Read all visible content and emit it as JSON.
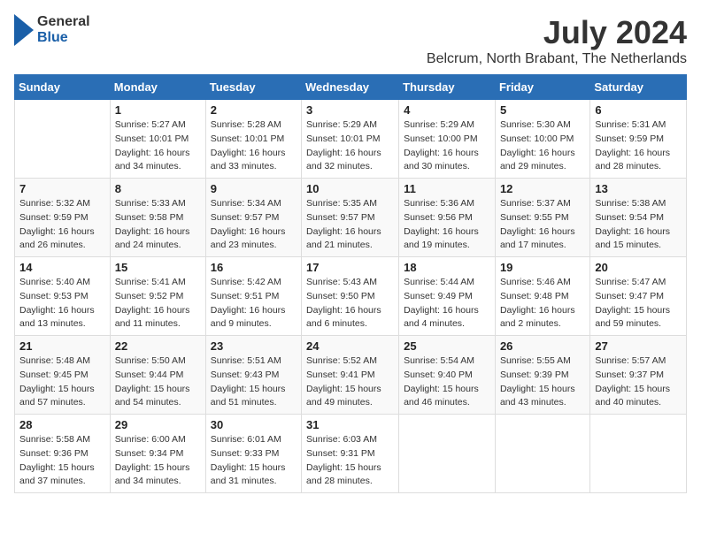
{
  "header": {
    "logo_general": "General",
    "logo_blue": "Blue",
    "month": "July 2024",
    "location": "Belcrum, North Brabant, The Netherlands"
  },
  "weekdays": [
    "Sunday",
    "Monday",
    "Tuesday",
    "Wednesday",
    "Thursday",
    "Friday",
    "Saturday"
  ],
  "weeks": [
    [
      {
        "day": "",
        "info": ""
      },
      {
        "day": "1",
        "info": "Sunrise: 5:27 AM\nSunset: 10:01 PM\nDaylight: 16 hours\nand 34 minutes."
      },
      {
        "day": "2",
        "info": "Sunrise: 5:28 AM\nSunset: 10:01 PM\nDaylight: 16 hours\nand 33 minutes."
      },
      {
        "day": "3",
        "info": "Sunrise: 5:29 AM\nSunset: 10:01 PM\nDaylight: 16 hours\nand 32 minutes."
      },
      {
        "day": "4",
        "info": "Sunrise: 5:29 AM\nSunset: 10:00 PM\nDaylight: 16 hours\nand 30 minutes."
      },
      {
        "day": "5",
        "info": "Sunrise: 5:30 AM\nSunset: 10:00 PM\nDaylight: 16 hours\nand 29 minutes."
      },
      {
        "day": "6",
        "info": "Sunrise: 5:31 AM\nSunset: 9:59 PM\nDaylight: 16 hours\nand 28 minutes."
      }
    ],
    [
      {
        "day": "7",
        "info": "Sunrise: 5:32 AM\nSunset: 9:59 PM\nDaylight: 16 hours\nand 26 minutes."
      },
      {
        "day": "8",
        "info": "Sunrise: 5:33 AM\nSunset: 9:58 PM\nDaylight: 16 hours\nand 24 minutes."
      },
      {
        "day": "9",
        "info": "Sunrise: 5:34 AM\nSunset: 9:57 PM\nDaylight: 16 hours\nand 23 minutes."
      },
      {
        "day": "10",
        "info": "Sunrise: 5:35 AM\nSunset: 9:57 PM\nDaylight: 16 hours\nand 21 minutes."
      },
      {
        "day": "11",
        "info": "Sunrise: 5:36 AM\nSunset: 9:56 PM\nDaylight: 16 hours\nand 19 minutes."
      },
      {
        "day": "12",
        "info": "Sunrise: 5:37 AM\nSunset: 9:55 PM\nDaylight: 16 hours\nand 17 minutes."
      },
      {
        "day": "13",
        "info": "Sunrise: 5:38 AM\nSunset: 9:54 PM\nDaylight: 16 hours\nand 15 minutes."
      }
    ],
    [
      {
        "day": "14",
        "info": "Sunrise: 5:40 AM\nSunset: 9:53 PM\nDaylight: 16 hours\nand 13 minutes."
      },
      {
        "day": "15",
        "info": "Sunrise: 5:41 AM\nSunset: 9:52 PM\nDaylight: 16 hours\nand 11 minutes."
      },
      {
        "day": "16",
        "info": "Sunrise: 5:42 AM\nSunset: 9:51 PM\nDaylight: 16 hours\nand 9 minutes."
      },
      {
        "day": "17",
        "info": "Sunrise: 5:43 AM\nSunset: 9:50 PM\nDaylight: 16 hours\nand 6 minutes."
      },
      {
        "day": "18",
        "info": "Sunrise: 5:44 AM\nSunset: 9:49 PM\nDaylight: 16 hours\nand 4 minutes."
      },
      {
        "day": "19",
        "info": "Sunrise: 5:46 AM\nSunset: 9:48 PM\nDaylight: 16 hours\nand 2 minutes."
      },
      {
        "day": "20",
        "info": "Sunrise: 5:47 AM\nSunset: 9:47 PM\nDaylight: 15 hours\nand 59 minutes."
      }
    ],
    [
      {
        "day": "21",
        "info": "Sunrise: 5:48 AM\nSunset: 9:45 PM\nDaylight: 15 hours\nand 57 minutes."
      },
      {
        "day": "22",
        "info": "Sunrise: 5:50 AM\nSunset: 9:44 PM\nDaylight: 15 hours\nand 54 minutes."
      },
      {
        "day": "23",
        "info": "Sunrise: 5:51 AM\nSunset: 9:43 PM\nDaylight: 15 hours\nand 51 minutes."
      },
      {
        "day": "24",
        "info": "Sunrise: 5:52 AM\nSunset: 9:41 PM\nDaylight: 15 hours\nand 49 minutes."
      },
      {
        "day": "25",
        "info": "Sunrise: 5:54 AM\nSunset: 9:40 PM\nDaylight: 15 hours\nand 46 minutes."
      },
      {
        "day": "26",
        "info": "Sunrise: 5:55 AM\nSunset: 9:39 PM\nDaylight: 15 hours\nand 43 minutes."
      },
      {
        "day": "27",
        "info": "Sunrise: 5:57 AM\nSunset: 9:37 PM\nDaylight: 15 hours\nand 40 minutes."
      }
    ],
    [
      {
        "day": "28",
        "info": "Sunrise: 5:58 AM\nSunset: 9:36 PM\nDaylight: 15 hours\nand 37 minutes."
      },
      {
        "day": "29",
        "info": "Sunrise: 6:00 AM\nSunset: 9:34 PM\nDaylight: 15 hours\nand 34 minutes."
      },
      {
        "day": "30",
        "info": "Sunrise: 6:01 AM\nSunset: 9:33 PM\nDaylight: 15 hours\nand 31 minutes."
      },
      {
        "day": "31",
        "info": "Sunrise: 6:03 AM\nSunset: 9:31 PM\nDaylight: 15 hours\nand 28 minutes."
      },
      {
        "day": "",
        "info": ""
      },
      {
        "day": "",
        "info": ""
      },
      {
        "day": "",
        "info": ""
      }
    ]
  ]
}
